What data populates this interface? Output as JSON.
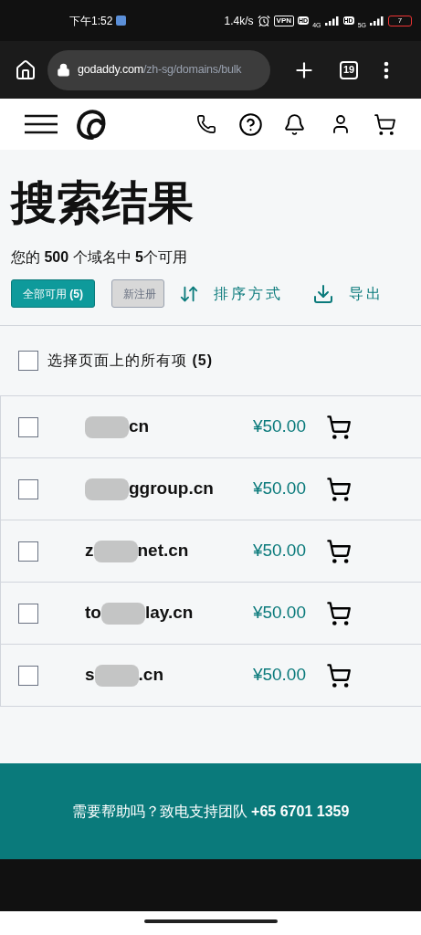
{
  "status_bar": {
    "time": "下午1:52",
    "speed": "1.4k/s",
    "vpn": "VPN",
    "hd_1": "HD",
    "network_1": "4G",
    "hd_2": "HD",
    "network_2": "5G",
    "battery": "7"
  },
  "browser": {
    "url_domain": "godaddy.com",
    "url_path": "/zh-sg/domains/bulk",
    "tab_count": "19"
  },
  "page": {
    "title": "搜索结果",
    "summary": "您的 **500** 个域名中 **5**个可用",
    "filters": [
      {
        "label": "全部可用 **(5)**",
        "selected": true
      },
      {
        "label": "新注册",
        "selected": false
      }
    ],
    "sort": "排序方式",
    "export": "导出",
    "select_all": {
      "label": "选择页面上的所有项 **(5)**",
      "checked": false
    },
    "results": [
      {
        "suffix": "cn",
        "price": "¥50.00",
        "checked": false
      },
      {
        "suffix": "ggroup.cn",
        "price": "¥50.00",
        "checked": false
      },
      {
        "prefix": "z",
        "suffix": "net.cn",
        "price": "¥50.00",
        "checked": false
      },
      {
        "prefix": "to",
        "suffix": "lay.cn",
        "price": "¥50.00",
        "checked": false
      },
      {
        "prefix": "s",
        "suffix": ".cn",
        "price": "¥50.00",
        "checked": false
      }
    ]
  },
  "footer": {
    "text": "需要帮助吗？致电支持团队 **+65 6701 1359**"
  }
}
